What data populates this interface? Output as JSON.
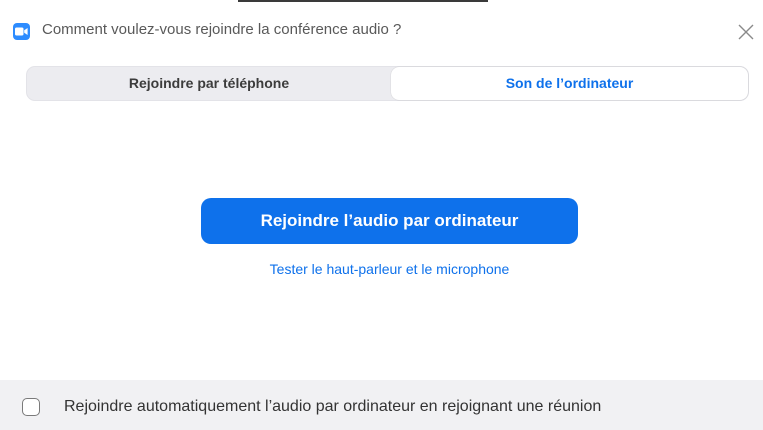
{
  "dialog": {
    "title": "Comment voulez-vous rejoindre la conférence audio ?",
    "app_icon": "zoom-camera-icon",
    "close_icon": "close-icon"
  },
  "tabs": [
    {
      "label": "Rejoindre par téléphone",
      "selected": false
    },
    {
      "label": "Son de l’ordinateur",
      "selected": true
    }
  ],
  "main": {
    "join_button_label": "Rejoindre l’audio par ordinateur",
    "test_link_label": "Tester le haut-parleur et le microphone"
  },
  "footer": {
    "auto_join_label": "Rejoindre automatiquement l’audio par ordinateur en rejoignant une réunion",
    "auto_join_checked": false
  },
  "colors": {
    "accent": "#0e71eb",
    "icon_blue": "#2d8cff",
    "footer_bg": "#f1f1f3",
    "tab_track": "#ececf0"
  }
}
